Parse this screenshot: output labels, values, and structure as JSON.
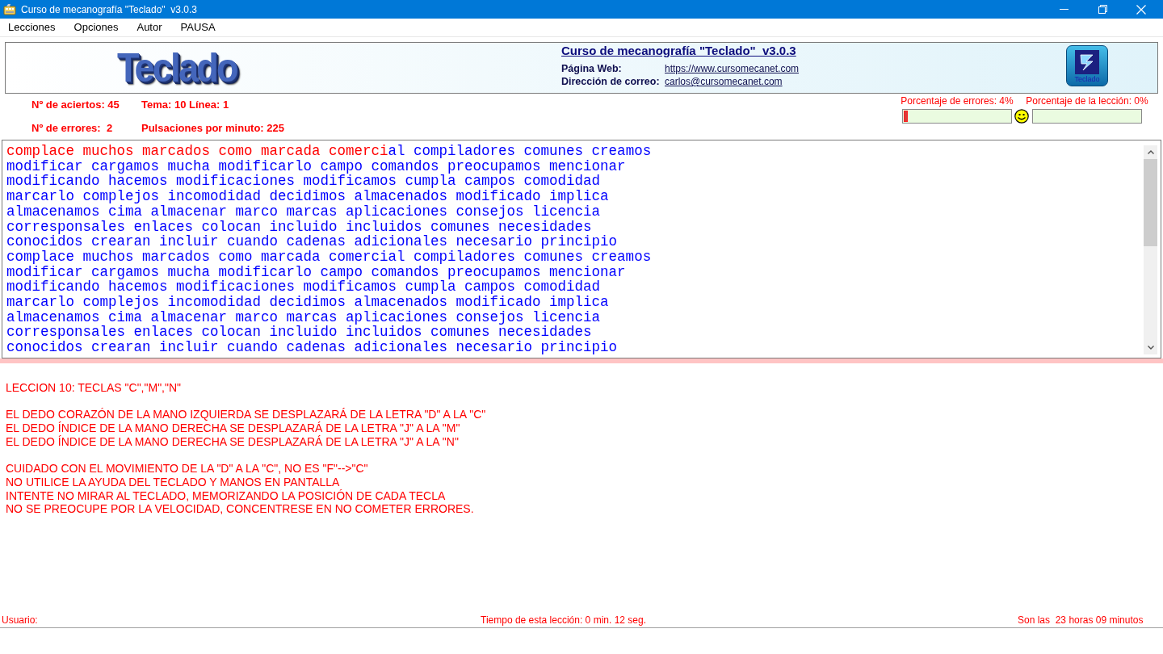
{
  "window": {
    "title": "Curso de mecanografía \"Teclado\"  v3.0.3"
  },
  "menu": [
    "Lecciones",
    "Opciones",
    "Autor",
    "PAUSA"
  ],
  "header": {
    "logo": "Teclado",
    "title": "Curso de mecanografía \"Teclado\"  v3.0.3",
    "fields": [
      {
        "label": "Página Web:",
        "value": "https://www.cursomecanet.com"
      },
      {
        "label": "Dirección de correo:",
        "value": "carlos@cursomecanet.com"
      }
    ],
    "badge": "Teclado"
  },
  "stats": [
    "Nº de aciertos: 45",
    "Tema: 10 Línea: 1",
    "Nº de errores:  2",
    "Pulsaciones por minuto: 225"
  ],
  "meters": [
    {
      "label": "Porcentaje de errores: 4%",
      "level": 0.04
    },
    {
      "label": "Porcentaje de la lección: 0%",
      "level": 0
    }
  ],
  "exercise": {
    "lines": [
      {
        "typed": "complace muchos marcados como marcada comerci",
        "text": "al compiladores comunes creamos"
      },
      {
        "text": "modificar cargamos mucha modificarlo campo comandos preocupamos mencionar"
      },
      {
        "text": "modificando hacemos modificaciones modificamos cumpla campos comodidad"
      },
      {
        "text": "marcarlo complejos incomodidad decidimos almacenados modificado implica"
      },
      {
        "text": "almacenamos cima almacenar marco marcas aplicaciones consejos licencia"
      },
      {
        "text": "corresponsales enlaces colocan incluido incluidos comunes necesidades"
      },
      {
        "text": "conocidos crearan incluir cuando cadenas adicionales necesario principio"
      },
      {
        "text": "complace muchos marcados como marcada comercial compiladores comunes creamos"
      },
      {
        "text": "modificar cargamos mucha modificarlo campo comandos preocupamos mencionar"
      },
      {
        "text": "modificando hacemos modificaciones modificamos cumpla campos comodidad"
      },
      {
        "text": "marcarlo complejos incomodidad decidimos almacenados modificado implica"
      },
      {
        "text": "almacenamos cima almacenar marco marcas aplicaciones consejos licencia"
      },
      {
        "text": "corresponsales enlaces colocan incluido incluidos comunes necesidades"
      },
      {
        "text": "conocidos crearan incluir cuando cadenas adicionales necesario principio"
      }
    ]
  },
  "instructions": [
    {
      "lines": [
        "LECCION 10: TECLAS \"C\",\"M\",\"N\""
      ]
    },
    {
      "lines": [
        "EL DEDO CORAZÓN DE LA MANO IZQUIERDA SE DESPLAZARÁ DE LA LETRA \"D\" A LA \"C\"",
        "EL DEDO ÍNDICE DE LA MANO DERECHA SE DESPLAZARÁ DE LA LETRA \"J\" A LA \"M\"",
        "EL DEDO ÍNDICE DE LA MANO DERECHA SE DESPLAZARÁ DE LA LETRA \"J\" A LA \"N\""
      ]
    },
    {
      "lines": [
        "CUIDADO CON EL MOVIMIENTO DE LA \"D\" A LA \"C\", NO ES \"F\"-->\"C\"",
        "NO UTILICE LA AYUDA DEL TECLADO Y MANOS EN PANTALLA",
        "INTENTE NO MIRAR AL TECLADO, MEMORIZANDO LA POSICIÓN DE CADA TECLA",
        "NO SE PREOCUPE POR LA VELOCIDAD, CONCENTRESE EN NO COMETER ERRORES."
      ]
    }
  ],
  "status_bar": [
    "Usuario:",
    "Tiempo de esta lección: 0 min. 12 seg.",
    "Son las  23 horas 09 minutos"
  ]
}
